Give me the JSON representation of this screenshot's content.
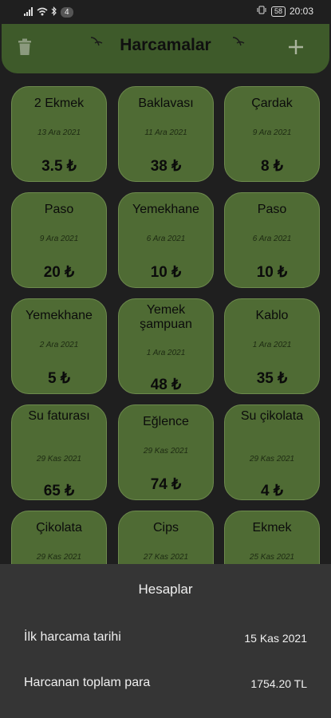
{
  "status_bar": {
    "notif_badge": "4",
    "battery": "58",
    "time": "20:03"
  },
  "app_bar": {
    "title": "Harcamalar"
  },
  "expenses": [
    {
      "title": "2 Ekmek",
      "date": "13 Ara 2021",
      "amount": "3.5 ₺"
    },
    {
      "title": "Baklavası",
      "date": "11 Ara 2021",
      "amount": "38 ₺"
    },
    {
      "title": "Çardak",
      "date": "9 Ara 2021",
      "amount": "8 ₺"
    },
    {
      "title": "Paso",
      "date": "9 Ara 2021",
      "amount": "20 ₺"
    },
    {
      "title": "Yemekhane",
      "date": "6 Ara 2021",
      "amount": "10 ₺"
    },
    {
      "title": "Paso",
      "date": "6 Ara 2021",
      "amount": "10 ₺"
    },
    {
      "title": "Yemekhane",
      "date": "2 Ara 2021",
      "amount": "5 ₺"
    },
    {
      "title": "Yemek şampuan",
      "date": "1 Ara 2021",
      "amount": "48 ₺"
    },
    {
      "title": "Kablo",
      "date": "1 Ara 2021",
      "amount": "35 ₺"
    },
    {
      "title": "Su faturası",
      "date": "29 Kas 2021",
      "amount": "65 ₺"
    },
    {
      "title": "Eğlence",
      "date": "29 Kas 2021",
      "amount": "74 ₺"
    },
    {
      "title": "Su çikolata",
      "date": "29 Kas 2021",
      "amount": "4 ₺"
    },
    {
      "title": "Çikolata",
      "date": "29 Kas 2021",
      "amount": ""
    },
    {
      "title": "Cips",
      "date": "27 Kas 2021",
      "amount": ""
    },
    {
      "title": "Ekmek",
      "date": "25 Kas 2021",
      "amount": ""
    }
  ],
  "summary": {
    "title": "Hesaplar",
    "first_expense_label": "İlk harcama tarihi",
    "first_expense_value": "15 Kas 2021",
    "total_label": "Harcanan toplam para",
    "total_value": "1754.20 TL"
  }
}
